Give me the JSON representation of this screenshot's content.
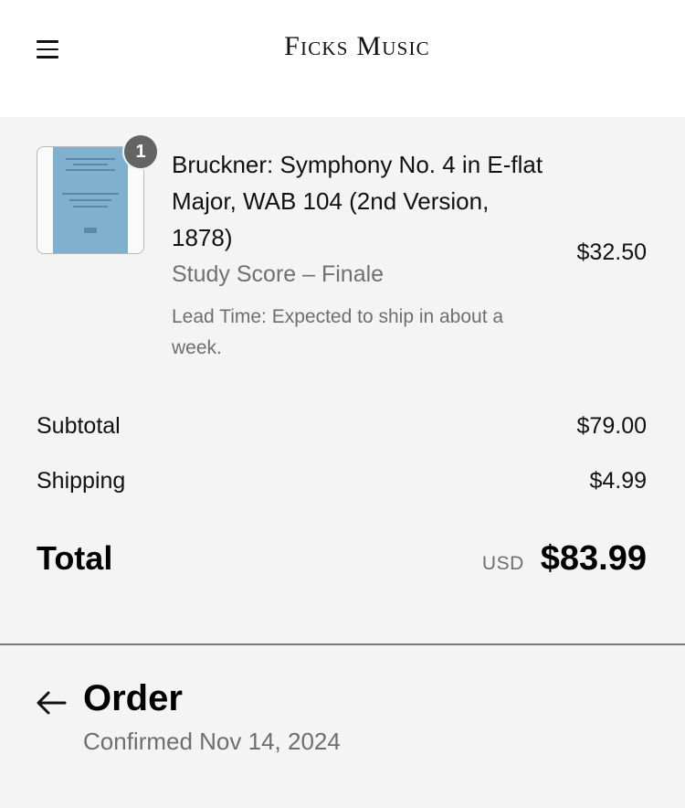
{
  "header": {
    "brand": "Ficks Music",
    "menu_icon": "hamburger-menu-icon"
  },
  "cart": {
    "items": [
      {
        "quantity": "1",
        "title": "Bruckner: Symphony No. 4 in E-flat Major, WAB 104 (2nd Version, 1878)",
        "variant": "Study Score – Finale",
        "lead_time": "Lead Time: Expected to ship in about a week.",
        "price": "$32.50",
        "cover_color": "#7fb1cf"
      }
    ]
  },
  "summary": {
    "subtotal_label": "Subtotal",
    "subtotal_value": "$79.00",
    "shipping_label": "Shipping",
    "shipping_value": "$4.99",
    "total_label": "Total",
    "currency": "USD",
    "total_value": "$83.99"
  },
  "order": {
    "title": "Order",
    "subtitle": "Confirmed Nov 14, 2024",
    "back_icon": "arrow-left-icon"
  }
}
